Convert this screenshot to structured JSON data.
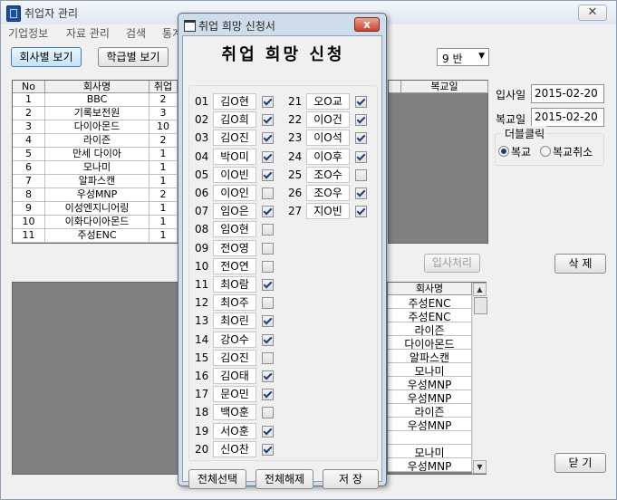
{
  "main": {
    "title": "취업자 관리",
    "menus": [
      "기업정보",
      "자료 관리",
      "검색",
      "통계"
    ],
    "view_company_label": "회사별 보기",
    "view_class_label": "학급별 보기",
    "class_select": "9 반",
    "company_table": {
      "headers": [
        "No",
        "회사명",
        "취업"
      ],
      "rows": [
        [
          "1",
          "BBC",
          "2"
        ],
        [
          "2",
          "기록보전원",
          "3"
        ],
        [
          "3",
          "다이아몬드",
          "10"
        ],
        [
          "4",
          "라이즌",
          "2"
        ],
        [
          "5",
          "만세 다이아",
          "1"
        ],
        [
          "6",
          "모나미",
          "1"
        ],
        [
          "7",
          "알파스캔",
          "1"
        ],
        [
          "8",
          "우성MNP",
          "2"
        ],
        [
          "9",
          "이성엔지니어링",
          "1"
        ],
        [
          "10",
          "이화다이아몬드",
          "1"
        ],
        [
          "11",
          "주성ENC",
          "1"
        ]
      ]
    },
    "return_col_header": "복교일",
    "hire_date_label": "입사일",
    "hire_date_value": "2015-02-20",
    "return_date_label": "복교일",
    "return_date_value": "2015-02-20",
    "double_click_label": "더블클릭",
    "radio_return": "복교",
    "radio_cancel": "복교취소",
    "hire_process_label": "입사처리",
    "delete_label": "삭 제",
    "close_label": "닫 기",
    "lower_list": {
      "header": "회사명",
      "items": [
        "주성ENC",
        "주성ENC",
        "라이즌",
        "다이아몬드",
        "알파스캔",
        "모나미",
        "우성MNP",
        "우성MNP",
        "라이즌",
        "우성MNP",
        "",
        "모나미",
        "우성MNP"
      ]
    }
  },
  "dialog": {
    "title": "취업 희망 신청서",
    "heading": "취업 희망 신청",
    "left_students": [
      {
        "num": "01",
        "name": "김O현",
        "checked": true
      },
      {
        "num": "02",
        "name": "김O희",
        "checked": true
      },
      {
        "num": "03",
        "name": "김O진",
        "checked": true
      },
      {
        "num": "04",
        "name": "박O미",
        "checked": true
      },
      {
        "num": "05",
        "name": "이O빈",
        "checked": true
      },
      {
        "num": "06",
        "name": "이O인",
        "checked": false
      },
      {
        "num": "07",
        "name": "임O은",
        "checked": true
      },
      {
        "num": "08",
        "name": "임O현",
        "checked": false
      },
      {
        "num": "09",
        "name": "전O영",
        "checked": false
      },
      {
        "num": "10",
        "name": "전O연",
        "checked": false
      },
      {
        "num": "11",
        "name": "최O람",
        "checked": true
      },
      {
        "num": "12",
        "name": "최O주",
        "checked": false
      },
      {
        "num": "13",
        "name": "최O린",
        "checked": true
      },
      {
        "num": "14",
        "name": "강O수",
        "checked": true
      },
      {
        "num": "15",
        "name": "김O진",
        "checked": false
      },
      {
        "num": "16",
        "name": "김O태",
        "checked": true
      },
      {
        "num": "17",
        "name": "문O민",
        "checked": true
      },
      {
        "num": "18",
        "name": "백O훈",
        "checked": false
      },
      {
        "num": "19",
        "name": "서O훈",
        "checked": true
      },
      {
        "num": "20",
        "name": "신O찬",
        "checked": true
      }
    ],
    "right_students": [
      {
        "num": "21",
        "name": "오O교",
        "checked": true
      },
      {
        "num": "22",
        "name": "이O건",
        "checked": true
      },
      {
        "num": "23",
        "name": "이O석",
        "checked": true
      },
      {
        "num": "24",
        "name": "이O후",
        "checked": true
      },
      {
        "num": "25",
        "name": "조O수",
        "checked": false
      },
      {
        "num": "26",
        "name": "조O우",
        "checked": true
      },
      {
        "num": "27",
        "name": "지O빈",
        "checked": true
      }
    ],
    "select_all_label": "전체선택",
    "deselect_all_label": "전체해제",
    "save_label": "저 장",
    "close_glyph": "x"
  }
}
